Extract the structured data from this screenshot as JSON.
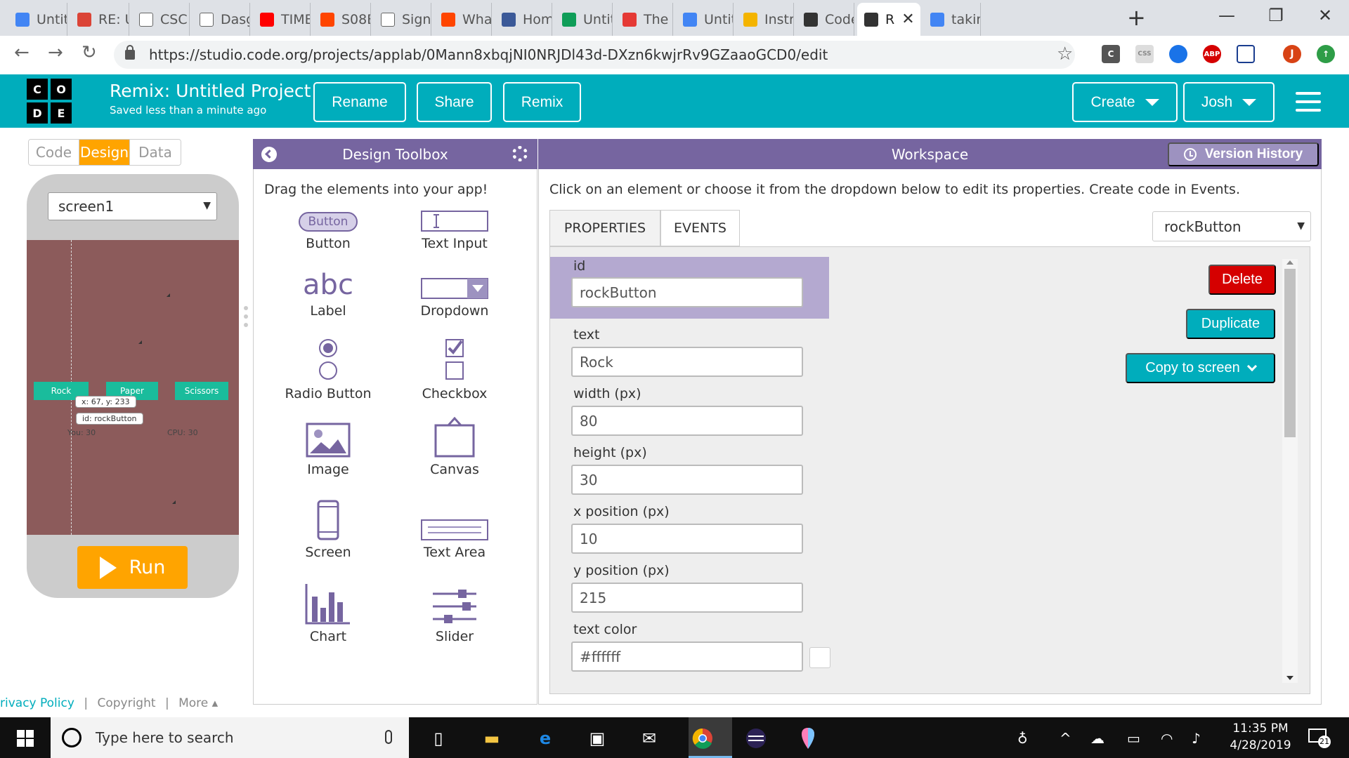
{
  "browser": {
    "tabs": [
      {
        "label": "Untit",
        "icon_color": "#4285f4",
        "icon": "doc"
      },
      {
        "label": "RE: U",
        "icon_color": "#db4437",
        "icon": "gmail"
      },
      {
        "label": "CSC",
        "icon_color": "#ffffff",
        "icon": "page"
      },
      {
        "label": "Dasg",
        "icon_color": "#ffffff",
        "icon": "page"
      },
      {
        "label": "TIME",
        "icon_color": "#ff0000",
        "icon": "youtube"
      },
      {
        "label": "S08E",
        "icon_color": "#ff4500",
        "icon": "reddit"
      },
      {
        "label": "Sign",
        "icon_color": "#ffffff",
        "icon": "page"
      },
      {
        "label": "What",
        "icon_color": "#ff4500",
        "icon": "reddit"
      },
      {
        "label": "Hom",
        "icon_color": "#3b5998",
        "icon": "shield"
      },
      {
        "label": "Untit",
        "icon_color": "#0f9d58",
        "icon": "sheets"
      },
      {
        "label": "The",
        "icon_color": "#e53935",
        "icon": "s-logo"
      },
      {
        "label": "Untit",
        "icon_color": "#4285f4",
        "icon": "doc"
      },
      {
        "label": "Instr",
        "icon_color": "#f4b400",
        "icon": "avatar"
      },
      {
        "label": "Code",
        "icon_color": "#333333",
        "icon": "grid"
      },
      {
        "label": "R",
        "icon_color": "#333333",
        "icon": "grid"
      },
      {
        "label": "takin",
        "icon_color": "#4285f4",
        "icon": "google"
      }
    ],
    "new_tab": "+",
    "url": "https://studio.code.org/projects/applab/0Mann8xbqjNI0NRJDl43d-DXzn6kwjrRv9GZaaoGCD0/edit",
    "extensions": [
      "C",
      "CSS",
      "",
      "ABP",
      "",
      "J",
      ""
    ]
  },
  "header": {
    "logo_letters": [
      "C",
      "O",
      "D",
      "E"
    ],
    "project_title": "Remix: Untitled Project",
    "saved_status": "Saved less than a minute ago",
    "rename": "Rename",
    "share": "Share",
    "remix": "Remix",
    "create": "Create",
    "user": "Josh"
  },
  "left": {
    "modes": [
      "Code",
      "Design",
      "Data"
    ],
    "active_mode": "Design",
    "screen_select": "screen1",
    "app": {
      "buttons": [
        "Rock",
        "Paper",
        "Scissors"
      ],
      "labels": {
        "you": "You: 30",
        "cpu": "CPU: 30"
      },
      "tooltip_xy": "x: 67, y: 233",
      "tooltip_id": "id: rockButton"
    },
    "run": "Run",
    "footer": [
      "rivacy Policy",
      "|",
      "Copyright",
      "|",
      "More ▴"
    ]
  },
  "toolbox": {
    "title": "Design Toolbox",
    "hint": "Drag the elements into your app!",
    "items": [
      {
        "label": "Button",
        "icon": "button-icon",
        "icon_text": "Button"
      },
      {
        "label": "Text Input",
        "icon": "text-input-icon"
      },
      {
        "label": "Label",
        "icon": "label-icon",
        "icon_text": "abc"
      },
      {
        "label": "Dropdown",
        "icon": "dropdown-icon"
      },
      {
        "label": "Radio Button",
        "icon": "radio-icon"
      },
      {
        "label": "Checkbox",
        "icon": "checkbox-icon"
      },
      {
        "label": "Image",
        "icon": "image-icon"
      },
      {
        "label": "Canvas",
        "icon": "canvas-icon"
      },
      {
        "label": "Screen",
        "icon": "screen-icon"
      },
      {
        "label": "Text Area",
        "icon": "text-area-icon"
      },
      {
        "label": "Chart",
        "icon": "chart-icon"
      },
      {
        "label": "Slider",
        "icon": "slider-icon"
      }
    ]
  },
  "workspace": {
    "title": "Workspace",
    "version_history": "Version History",
    "hint": "Click on an element or choose it from the dropdown below to edit its properties. Create code in Events.",
    "tabs": [
      "PROPERTIES",
      "EVENTS"
    ],
    "element_select": "rockButton",
    "properties": [
      {
        "label": "id",
        "value": "rockButton"
      },
      {
        "label": "text",
        "value": "Rock"
      },
      {
        "label": "width (px)",
        "value": "80"
      },
      {
        "label": "height (px)",
        "value": "30"
      },
      {
        "label": "x position (px)",
        "value": "10"
      },
      {
        "label": "y position (px)",
        "value": "215"
      },
      {
        "label": "text color",
        "value": "#ffffff"
      }
    ],
    "delete": "Delete",
    "duplicate": "Duplicate",
    "copy_to_screen": "Copy to screen"
  },
  "taskbar": {
    "search_placeholder": "Type here to search",
    "time": "11:35 PM",
    "date": "4/28/2019",
    "notifications": "21"
  },
  "colors": {
    "codeorg_teal": "#00adbc",
    "toolbox_purple": "#7665a0",
    "run_orange": "#ffa400",
    "delete_red": "#d50000",
    "action_teal": "#00adbc",
    "app_bg": "#8c5b5b",
    "app_button": "#1abc9c"
  }
}
